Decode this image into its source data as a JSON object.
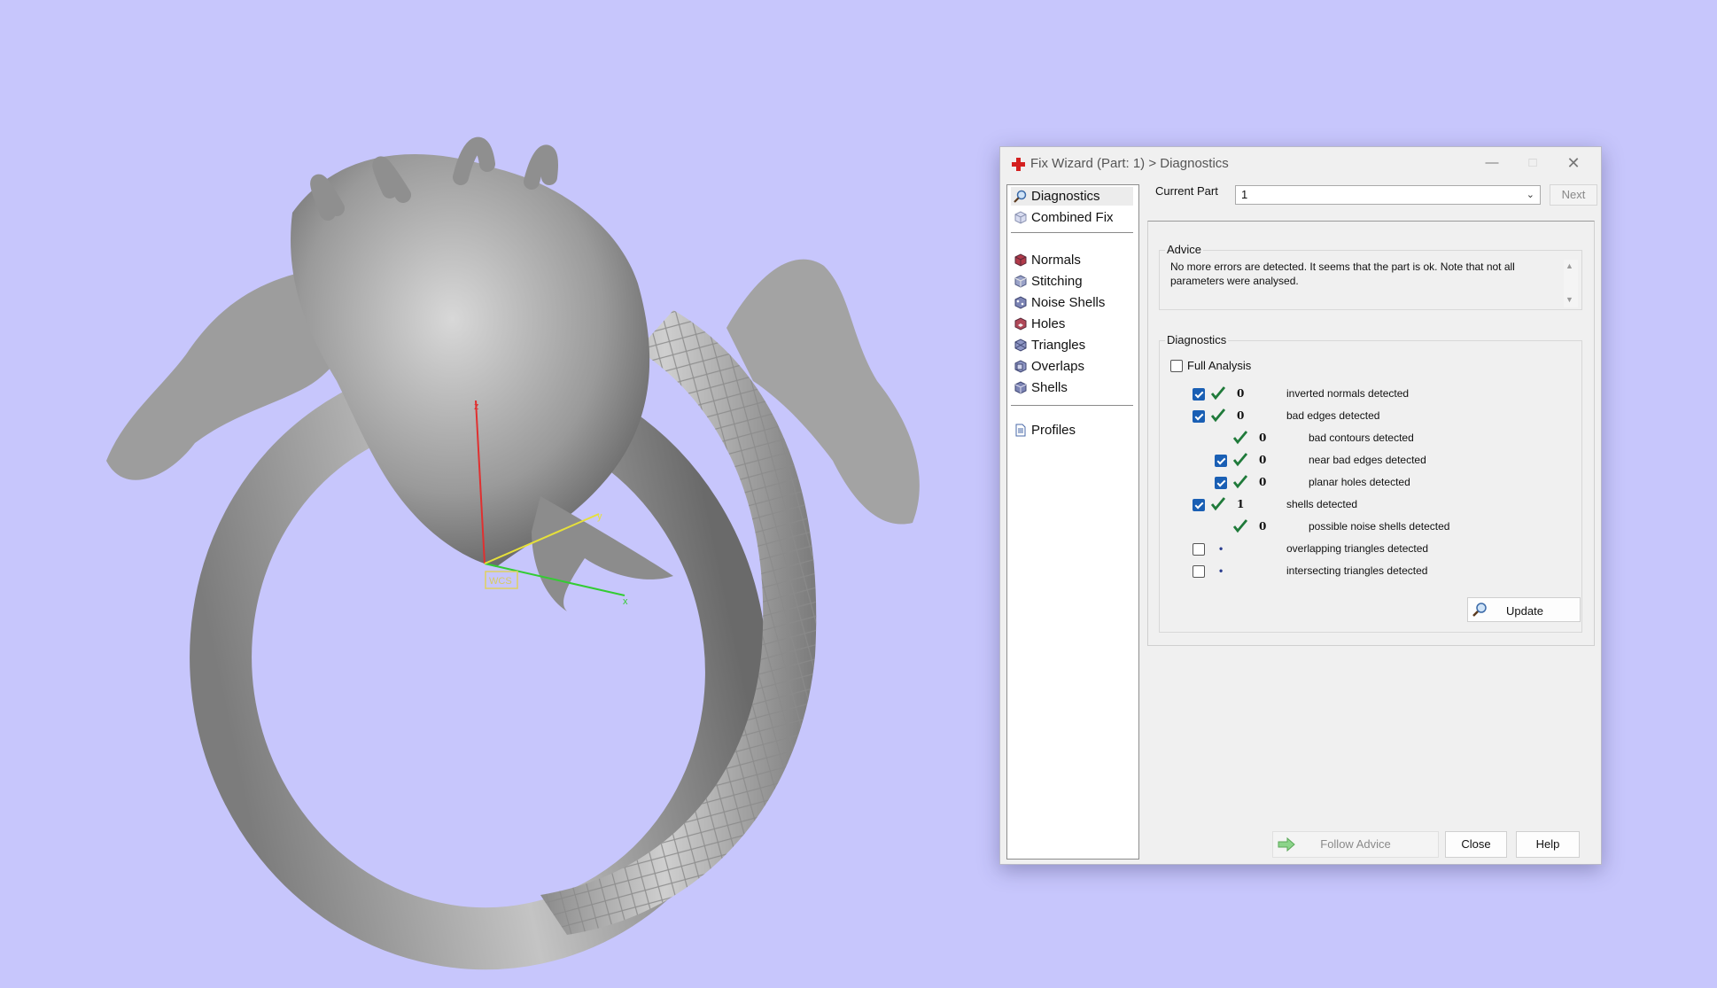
{
  "window": {
    "title": "Fix Wizard (Part: 1) > Diagnostics"
  },
  "viewport": {
    "axis_labels": {
      "x": "x",
      "y": "y",
      "z": "z",
      "origin": "WCS"
    }
  },
  "sidebar": {
    "items": [
      {
        "label": "Diagnostics",
        "icon": "magnifier-icon",
        "selected": true
      },
      {
        "label": "Combined Fix",
        "icon": "cube-icon"
      },
      {
        "label": "Normals",
        "icon": "normals-cube-icon"
      },
      {
        "label": "Stitching",
        "icon": "stitching-icon"
      },
      {
        "label": "Noise Shells",
        "icon": "noise-shells-icon"
      },
      {
        "label": "Holes",
        "icon": "holes-icon"
      },
      {
        "label": "Triangles",
        "icon": "triangles-icon"
      },
      {
        "label": "Overlaps",
        "icon": "overlaps-icon"
      },
      {
        "label": "Shells",
        "icon": "shells-icon"
      },
      {
        "label": "Profiles",
        "icon": "document-icon"
      }
    ]
  },
  "current_part": {
    "label": "Current Part",
    "value": "1",
    "next_label": "Next"
  },
  "advice": {
    "title": "Advice",
    "text": "No more errors are detected. It seems that the part is ok. Note that not all parameters were analysed."
  },
  "diagnostics": {
    "title": "Diagnostics",
    "full_analysis_label": "Full Analysis",
    "rows": [
      {
        "value": "0",
        "label": "inverted normals detected",
        "checked": true,
        "status": "ok",
        "indent": 0
      },
      {
        "value": "0",
        "label": "bad edges detected",
        "checked": true,
        "status": "ok",
        "indent": 0
      },
      {
        "value": "0",
        "label": "bad contours detected",
        "checked": null,
        "status": "ok",
        "indent": 1
      },
      {
        "value": "0",
        "label": "near bad edges detected",
        "checked": true,
        "status": "ok",
        "indent": 1
      },
      {
        "value": "0",
        "label": "planar holes detected",
        "checked": true,
        "status": "ok",
        "indent": 1
      },
      {
        "value": "1",
        "label": "shells detected",
        "checked": true,
        "status": "ok",
        "indent": 0
      },
      {
        "value": "0",
        "label": "possible noise shells detected",
        "checked": null,
        "status": "ok",
        "indent": 1
      },
      {
        "value": "•",
        "label": "overlapping triangles detected",
        "checked": false,
        "status": "unknown",
        "indent": 0
      },
      {
        "value": "•",
        "label": "intersecting triangles detected",
        "checked": false,
        "status": "unknown",
        "indent": 0
      }
    ],
    "update_label": "Update"
  },
  "footer": {
    "follow_advice_label": "Follow Advice",
    "close_label": "Close",
    "help_label": "Help"
  },
  "colors": {
    "background": "#c7c6fc",
    "check_green": "#1f7a3a",
    "checkbox_blue": "#1a5fb4",
    "title_icon_red": "#d42020"
  }
}
